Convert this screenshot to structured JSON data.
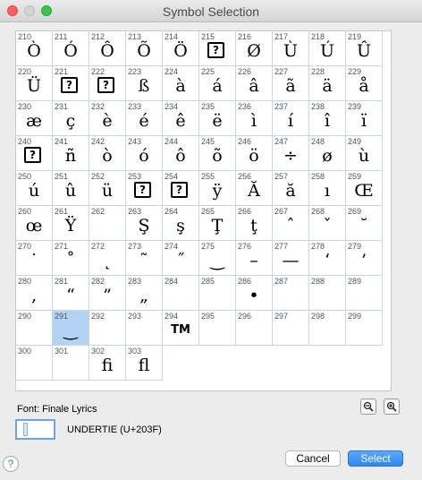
{
  "window": {
    "title": "Symbol Selection"
  },
  "grid": {
    "selected_index": 81,
    "cells": [
      {
        "code": "210",
        "glyph": "Ò"
      },
      {
        "code": "211",
        "glyph": "Ó"
      },
      {
        "code": "212",
        "glyph": "Ô"
      },
      {
        "code": "213",
        "glyph": "Õ"
      },
      {
        "code": "214",
        "glyph": "Ö"
      },
      {
        "code": "215",
        "glyph": "?",
        "missing": true
      },
      {
        "code": "216",
        "glyph": "Ø"
      },
      {
        "code": "217",
        "glyph": "Ù"
      },
      {
        "code": "218",
        "glyph": "Ú"
      },
      {
        "code": "219",
        "glyph": "Û"
      },
      {
        "code": "220",
        "glyph": "Ü"
      },
      {
        "code": "221",
        "glyph": "?",
        "missing": true
      },
      {
        "code": "222",
        "glyph": "?",
        "missing": true
      },
      {
        "code": "223",
        "glyph": "ß"
      },
      {
        "code": "224",
        "glyph": "à"
      },
      {
        "code": "225",
        "glyph": "á"
      },
      {
        "code": "226",
        "glyph": "â"
      },
      {
        "code": "227",
        "glyph": "ã"
      },
      {
        "code": "228",
        "glyph": "ä"
      },
      {
        "code": "229",
        "glyph": "å"
      },
      {
        "code": "230",
        "glyph": "æ"
      },
      {
        "code": "231",
        "glyph": "ç"
      },
      {
        "code": "232",
        "glyph": "è"
      },
      {
        "code": "233",
        "glyph": "é"
      },
      {
        "code": "234",
        "glyph": "ê"
      },
      {
        "code": "235",
        "glyph": "ë"
      },
      {
        "code": "236",
        "glyph": "ì"
      },
      {
        "code": "237",
        "glyph": "í"
      },
      {
        "code": "238",
        "glyph": "î"
      },
      {
        "code": "239",
        "glyph": "ï"
      },
      {
        "code": "240",
        "glyph": "?",
        "missing": true
      },
      {
        "code": "241",
        "glyph": "ñ"
      },
      {
        "code": "242",
        "glyph": "ò"
      },
      {
        "code": "243",
        "glyph": "ó"
      },
      {
        "code": "244",
        "glyph": "ô"
      },
      {
        "code": "245",
        "glyph": "õ"
      },
      {
        "code": "246",
        "glyph": "ö"
      },
      {
        "code": "247",
        "glyph": "÷"
      },
      {
        "code": "248",
        "glyph": "ø"
      },
      {
        "code": "249",
        "glyph": "ù"
      },
      {
        "code": "250",
        "glyph": "ú"
      },
      {
        "code": "251",
        "glyph": "û"
      },
      {
        "code": "252",
        "glyph": "ü"
      },
      {
        "code": "253",
        "glyph": "?",
        "missing": true
      },
      {
        "code": "254",
        "glyph": "?",
        "missing": true
      },
      {
        "code": "255",
        "glyph": "ÿ"
      },
      {
        "code": "256",
        "glyph": "Ă"
      },
      {
        "code": "257",
        "glyph": "ă"
      },
      {
        "code": "258",
        "glyph": "ı"
      },
      {
        "code": "259",
        "glyph": "Œ"
      },
      {
        "code": "260",
        "glyph": "œ"
      },
      {
        "code": "261",
        "glyph": "Ÿ"
      },
      {
        "code": "262",
        "glyph": ""
      },
      {
        "code": "263",
        "glyph": "Ş"
      },
      {
        "code": "264",
        "glyph": "ş"
      },
      {
        "code": "265",
        "glyph": "Ţ"
      },
      {
        "code": "266",
        "glyph": "ţ"
      },
      {
        "code": "267",
        "glyph": "ˆ"
      },
      {
        "code": "268",
        "glyph": "ˇ"
      },
      {
        "code": "269",
        "glyph": "˘"
      },
      {
        "code": "270",
        "glyph": "˙"
      },
      {
        "code": "271",
        "glyph": "˚"
      },
      {
        "code": "272",
        "glyph": "˛"
      },
      {
        "code": "273",
        "glyph": "˜"
      },
      {
        "code": "274",
        "glyph": "˝"
      },
      {
        "code": "275",
        "glyph": "‿"
      },
      {
        "code": "276",
        "glyph": "–"
      },
      {
        "code": "277",
        "glyph": "—"
      },
      {
        "code": "278",
        "glyph": "‘"
      },
      {
        "code": "279",
        "glyph": "’"
      },
      {
        "code": "280",
        "glyph": "‚"
      },
      {
        "code": "281",
        "glyph": "“"
      },
      {
        "code": "282",
        "glyph": "”"
      },
      {
        "code": "283",
        "glyph": "„"
      },
      {
        "code": "284",
        "glyph": ""
      },
      {
        "code": "285",
        "glyph": ""
      },
      {
        "code": "286",
        "glyph": "•"
      },
      {
        "code": "287",
        "glyph": ""
      },
      {
        "code": "288",
        "glyph": ""
      },
      {
        "code": "289",
        "glyph": ""
      },
      {
        "code": "290",
        "glyph": ""
      },
      {
        "code": "291",
        "glyph": "‿"
      },
      {
        "code": "292",
        "glyph": ""
      },
      {
        "code": "293",
        "glyph": ""
      },
      {
        "code": "294",
        "glyph": "TM",
        "small": true
      },
      {
        "code": "295",
        "glyph": ""
      },
      {
        "code": "296",
        "glyph": ""
      },
      {
        "code": "297",
        "glyph": ""
      },
      {
        "code": "298",
        "glyph": ""
      },
      {
        "code": "299",
        "glyph": ""
      },
      {
        "code": "300",
        "glyph": ""
      },
      {
        "code": "301",
        "glyph": ""
      },
      {
        "code": "302",
        "glyph": "ﬁ"
      },
      {
        "code": "303",
        "glyph": "ﬂ"
      }
    ]
  },
  "footer": {
    "font_label": "Font:  Finale Lyrics",
    "preview_glyph": "‿",
    "char_name": "UNDERTIE (U+203F)",
    "help_label": "?",
    "cancel_label": "Cancel",
    "select_label": "Select",
    "zoom_out_icon": "zoom-out-icon",
    "zoom_in_icon": "zoom-in-icon"
  }
}
